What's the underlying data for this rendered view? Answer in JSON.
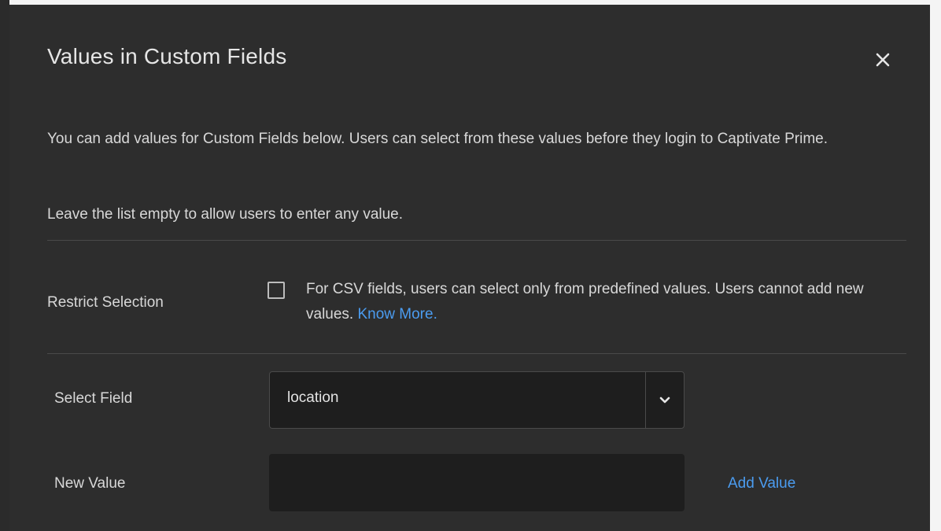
{
  "dialog": {
    "title": "Values in Custom Fields",
    "description_line1": "You can add values for Custom Fields below. Users can select from these values before they login to Captivate Prime.",
    "description_line2": "Leave the list empty to allow users to enter any value."
  },
  "restrict_selection": {
    "label": "Restrict Selection",
    "checked": false,
    "help_text": "For CSV fields, users can select only from predefined values. Users cannot add new values.",
    "link_text": "Know More."
  },
  "select_field": {
    "label": "Select Field",
    "selected_value": "location"
  },
  "new_value": {
    "label": "New Value",
    "value": "",
    "add_button_label": "Add Value"
  },
  "colors": {
    "modal_bg": "#2d2d2d",
    "input_bg": "#1e1e1e",
    "link": "#4b9cf0",
    "text": "#d8d8d8"
  },
  "icons": {
    "close": "close-icon",
    "dropdown": "chevron-down-icon"
  }
}
